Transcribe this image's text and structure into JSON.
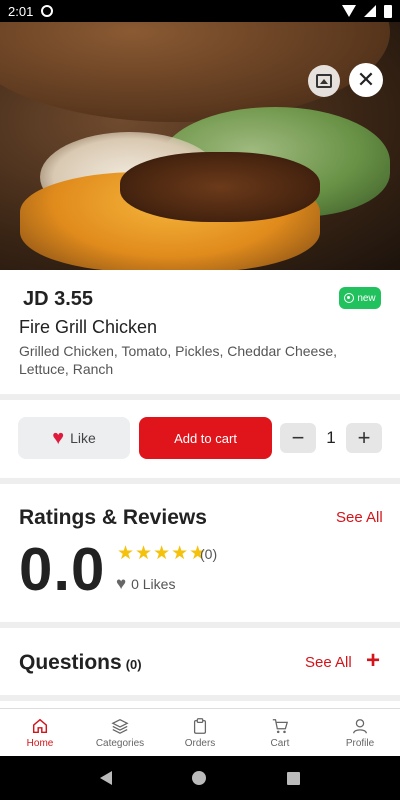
{
  "status_bar": {
    "time": "2:01"
  },
  "product": {
    "price": "JD 3.55",
    "badge": "new",
    "name": "Fire Grill Chicken",
    "description": "Grilled Chicken, Tomato, Pickles, Cheddar Cheese, Lettuce, Ranch"
  },
  "actions": {
    "like_label": "Like",
    "add_to_cart_label": "Add to cart",
    "quantity": "1"
  },
  "ratings": {
    "title": "Ratings & Reviews",
    "see_all": "See All",
    "score": "0.0",
    "stars": "★★★★★",
    "count": "(0)",
    "likes": "0 Likes"
  },
  "questions": {
    "title": "Questions",
    "count": "(0)",
    "see_all": "See All"
  },
  "bottom_nav": {
    "items": [
      {
        "label": "Home",
        "icon": "home-icon",
        "active": true
      },
      {
        "label": "Categories",
        "icon": "layers-icon",
        "active": false
      },
      {
        "label": "Orders",
        "icon": "clipboard-icon",
        "active": false
      },
      {
        "label": "Cart",
        "icon": "cart-icon",
        "active": false
      },
      {
        "label": "Profile",
        "icon": "person-icon",
        "active": false
      }
    ]
  },
  "colors": {
    "accent": "#e0141b",
    "badge": "#21c25e",
    "star": "#f4c20d"
  }
}
